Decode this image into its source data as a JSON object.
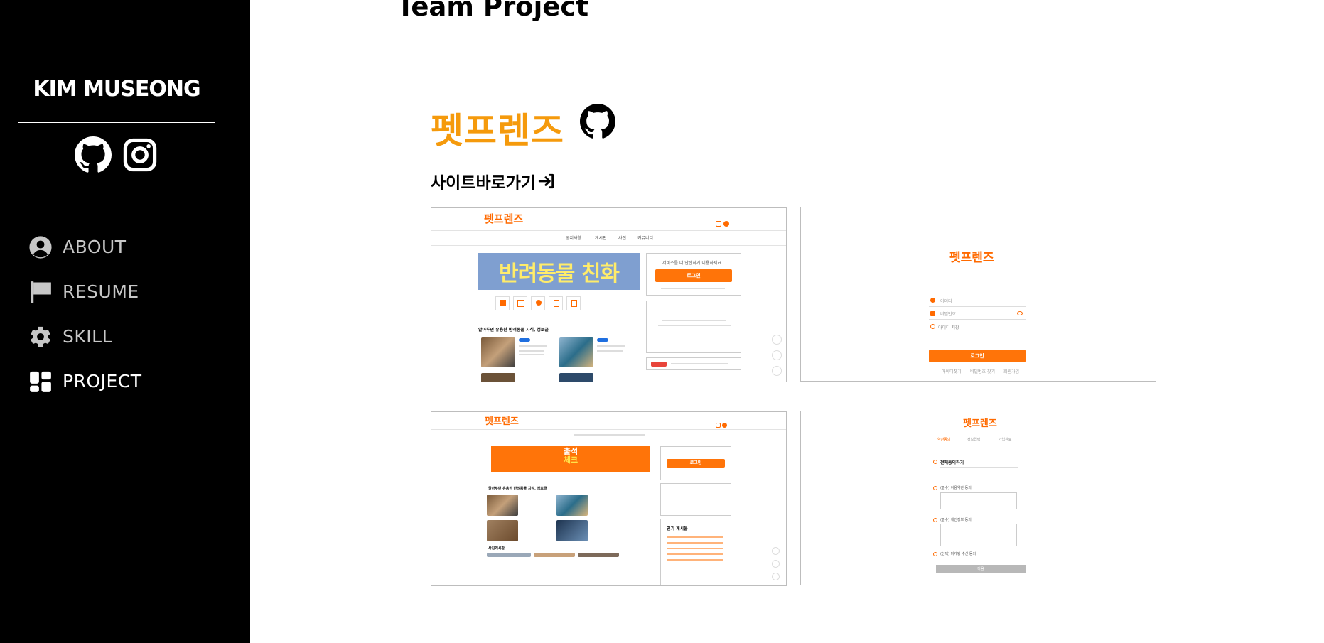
{
  "sidebar": {
    "brand": "KIM MUSEONG",
    "social_icons": [
      "github-icon",
      "instagram-icon"
    ],
    "nav": [
      {
        "label": "ABOUT",
        "icon": "user-circle-icon",
        "active": false
      },
      {
        "label": "RESUME",
        "icon": "flag-icon",
        "active": false
      },
      {
        "label": "SKILL",
        "icon": "gear-icon",
        "active": false
      },
      {
        "label": "PROJECT",
        "icon": "grid-icon",
        "active": true
      }
    ]
  },
  "main": {
    "section_title": "Team Project",
    "project": {
      "name": "펫프렌즈",
      "name_color": "#f59a0c",
      "repo_icon": "github-icon",
      "site_link_label": "사이트바로가기",
      "site_link_icon": "sign-in-arrow-icon"
    },
    "screenshots": [
      {
        "logo": "펫프렌즈",
        "nav": [
          "공지사항",
          "게시판",
          "사진",
          "커뮤니티"
        ],
        "banner": "반려동물 친화",
        "login_prompt": "서비스를 더 안전하게 이용하세요",
        "login_button": "로그인",
        "section": "알아두면 유용한 반려동물 지식, 정보글",
        "badge": "주의 참고"
      },
      {
        "logo": "펫프렌즈",
        "id_placeholder": "아이디",
        "pw_placeholder": "비밀번호",
        "remember": "아이디 저장",
        "login_button": "로그인",
        "footer_links": [
          "아이디찾기",
          "비밀번호 찾기",
          "회원가입"
        ]
      },
      {
        "logo": "펫프렌즈",
        "banner_line1": "출석",
        "banner_line2": "체크",
        "login_button": "로그인",
        "section": "알아두면 유용한 반려동물 지식, 정보글",
        "popular": "인기 게시물",
        "gallery": "사진게시판"
      },
      {
        "logo": "펫프렌즈",
        "steps": [
          "약관동의",
          "정보입력",
          "가입완료"
        ],
        "agree_all": "전체동의하기",
        "terms_1": "(필수) 이용약관 동의",
        "terms_2": "(필수) 개인정보 동의",
        "terms_3": "(선택) 마케팅 수신 동의",
        "next_button": "다음"
      }
    ]
  },
  "colors": {
    "sidebar_bg": "#000000",
    "accent": "#ff7409",
    "project_title": "#f59a0c"
  }
}
